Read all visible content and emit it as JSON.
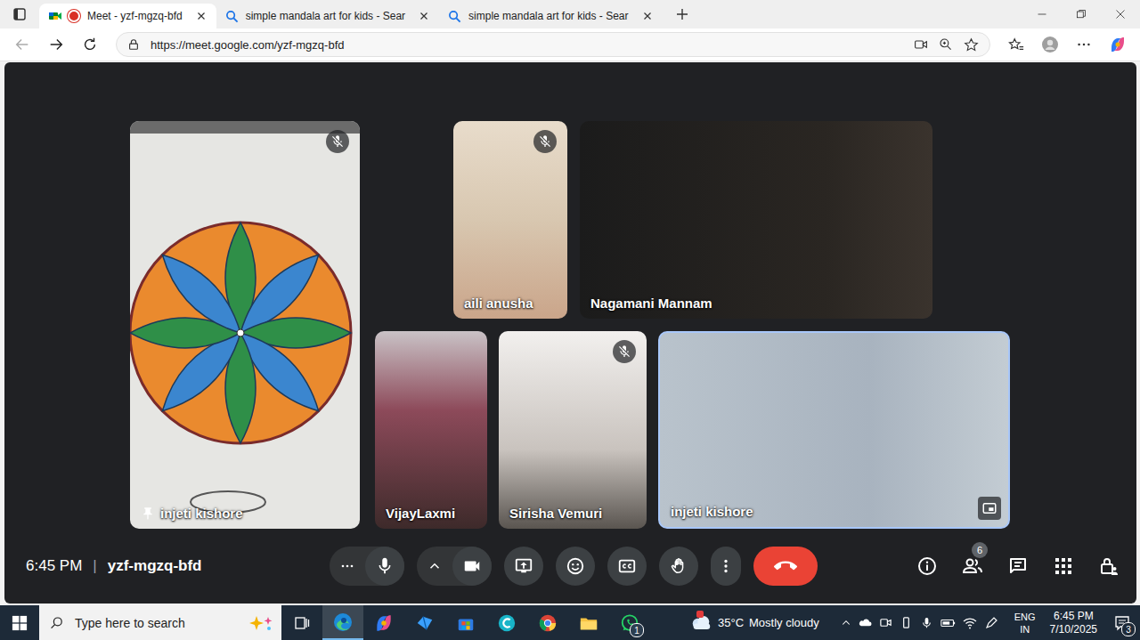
{
  "browser": {
    "tabs": [
      {
        "label": "Meet - yzf-mgzq-bfd",
        "selected": true,
        "recording": true
      },
      {
        "label": "simple mandala art for kids - Sear",
        "selected": false,
        "recording": false
      },
      {
        "label": "simple mandala art for kids - Sear",
        "selected": false,
        "recording": false
      }
    ],
    "url": "https://meet.google.com/yzf-mgzq-bfd"
  },
  "meeting": {
    "tiles": [
      {
        "name": "injeti kishore",
        "muted": true,
        "pinned": true,
        "speaking": false,
        "pip": false
      },
      {
        "name": "aili anusha",
        "muted": true,
        "pinned": false,
        "speaking": false,
        "pip": false
      },
      {
        "name": "Nagamani Mannam",
        "muted": false,
        "pinned": false,
        "speaking": false,
        "pip": false
      },
      {
        "name": "VijayLaxmi",
        "muted": false,
        "pinned": false,
        "speaking": false,
        "pip": false
      },
      {
        "name": "Sirisha Vemuri",
        "muted": true,
        "pinned": false,
        "speaking": false,
        "pip": false
      },
      {
        "name": "injeti kishore",
        "muted": false,
        "pinned": false,
        "speaking": true,
        "pip": true
      }
    ],
    "time": "6:45 PM",
    "separator": "|",
    "code": "yzf-mgzq-bfd",
    "controls": {
      "mic_on": true,
      "camera_on": true,
      "captions_on": false,
      "hand_raised": false
    },
    "participants_count": "6"
  },
  "taskbar": {
    "search_placeholder": "Type here to search",
    "edge_selected": true,
    "whatsapp_badge": "1",
    "temperature": "35°C",
    "weather": "Mostly cloudy",
    "language": "ENG",
    "region": "IN",
    "time": "6:45 PM",
    "date": "7/10/2025",
    "notifications": "3"
  }
}
